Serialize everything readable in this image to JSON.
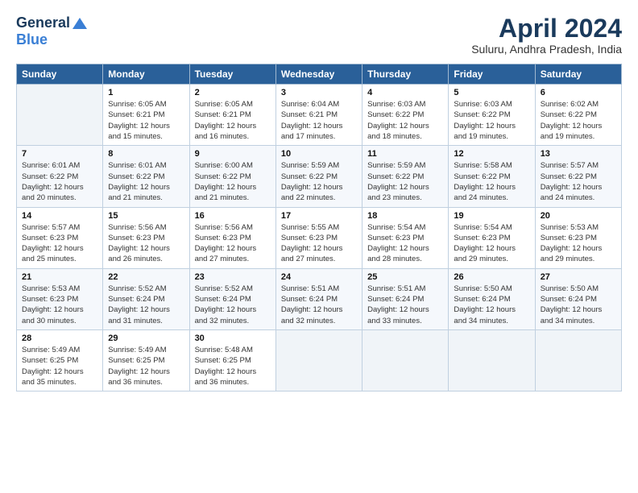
{
  "logo": {
    "general": "General",
    "blue": "Blue"
  },
  "header": {
    "title": "April 2024",
    "location": "Suluru, Andhra Pradesh, India"
  },
  "weekdays": [
    "Sunday",
    "Monday",
    "Tuesday",
    "Wednesday",
    "Thursday",
    "Friday",
    "Saturday"
  ],
  "weeks": [
    [
      {
        "day": "",
        "sunrise": "",
        "sunset": "",
        "daylight": ""
      },
      {
        "day": "1",
        "sunrise": "6:05 AM",
        "sunset": "6:21 PM",
        "daylight": "12 hours and 15 minutes."
      },
      {
        "day": "2",
        "sunrise": "6:05 AM",
        "sunset": "6:21 PM",
        "daylight": "12 hours and 16 minutes."
      },
      {
        "day": "3",
        "sunrise": "6:04 AM",
        "sunset": "6:21 PM",
        "daylight": "12 hours and 17 minutes."
      },
      {
        "day": "4",
        "sunrise": "6:03 AM",
        "sunset": "6:22 PM",
        "daylight": "12 hours and 18 minutes."
      },
      {
        "day": "5",
        "sunrise": "6:03 AM",
        "sunset": "6:22 PM",
        "daylight": "12 hours and 19 minutes."
      },
      {
        "day": "6",
        "sunrise": "6:02 AM",
        "sunset": "6:22 PM",
        "daylight": "12 hours and 19 minutes."
      }
    ],
    [
      {
        "day": "7",
        "sunrise": "6:01 AM",
        "sunset": "6:22 PM",
        "daylight": "12 hours and 20 minutes."
      },
      {
        "day": "8",
        "sunrise": "6:01 AM",
        "sunset": "6:22 PM",
        "daylight": "12 hours and 21 minutes."
      },
      {
        "day": "9",
        "sunrise": "6:00 AM",
        "sunset": "6:22 PM",
        "daylight": "12 hours and 21 minutes."
      },
      {
        "day": "10",
        "sunrise": "5:59 AM",
        "sunset": "6:22 PM",
        "daylight": "12 hours and 22 minutes."
      },
      {
        "day": "11",
        "sunrise": "5:59 AM",
        "sunset": "6:22 PM",
        "daylight": "12 hours and 23 minutes."
      },
      {
        "day": "12",
        "sunrise": "5:58 AM",
        "sunset": "6:22 PM",
        "daylight": "12 hours and 24 minutes."
      },
      {
        "day": "13",
        "sunrise": "5:57 AM",
        "sunset": "6:22 PM",
        "daylight": "12 hours and 24 minutes."
      }
    ],
    [
      {
        "day": "14",
        "sunrise": "5:57 AM",
        "sunset": "6:23 PM",
        "daylight": "12 hours and 25 minutes."
      },
      {
        "day": "15",
        "sunrise": "5:56 AM",
        "sunset": "6:23 PM",
        "daylight": "12 hours and 26 minutes."
      },
      {
        "day": "16",
        "sunrise": "5:56 AM",
        "sunset": "6:23 PM",
        "daylight": "12 hours and 27 minutes."
      },
      {
        "day": "17",
        "sunrise": "5:55 AM",
        "sunset": "6:23 PM",
        "daylight": "12 hours and 27 minutes."
      },
      {
        "day": "18",
        "sunrise": "5:54 AM",
        "sunset": "6:23 PM",
        "daylight": "12 hours and 28 minutes."
      },
      {
        "day": "19",
        "sunrise": "5:54 AM",
        "sunset": "6:23 PM",
        "daylight": "12 hours and 29 minutes."
      },
      {
        "day": "20",
        "sunrise": "5:53 AM",
        "sunset": "6:23 PM",
        "daylight": "12 hours and 29 minutes."
      }
    ],
    [
      {
        "day": "21",
        "sunrise": "5:53 AM",
        "sunset": "6:23 PM",
        "daylight": "12 hours and 30 minutes."
      },
      {
        "day": "22",
        "sunrise": "5:52 AM",
        "sunset": "6:24 PM",
        "daylight": "12 hours and 31 minutes."
      },
      {
        "day": "23",
        "sunrise": "5:52 AM",
        "sunset": "6:24 PM",
        "daylight": "12 hours and 32 minutes."
      },
      {
        "day": "24",
        "sunrise": "5:51 AM",
        "sunset": "6:24 PM",
        "daylight": "12 hours and 32 minutes."
      },
      {
        "day": "25",
        "sunrise": "5:51 AM",
        "sunset": "6:24 PM",
        "daylight": "12 hours and 33 minutes."
      },
      {
        "day": "26",
        "sunrise": "5:50 AM",
        "sunset": "6:24 PM",
        "daylight": "12 hours and 34 minutes."
      },
      {
        "day": "27",
        "sunrise": "5:50 AM",
        "sunset": "6:24 PM",
        "daylight": "12 hours and 34 minutes."
      }
    ],
    [
      {
        "day": "28",
        "sunrise": "5:49 AM",
        "sunset": "6:25 PM",
        "daylight": "12 hours and 35 minutes."
      },
      {
        "day": "29",
        "sunrise": "5:49 AM",
        "sunset": "6:25 PM",
        "daylight": "12 hours and 36 minutes."
      },
      {
        "day": "30",
        "sunrise": "5:48 AM",
        "sunset": "6:25 PM",
        "daylight": "12 hours and 36 minutes."
      },
      {
        "day": "",
        "sunrise": "",
        "sunset": "",
        "daylight": ""
      },
      {
        "day": "",
        "sunrise": "",
        "sunset": "",
        "daylight": ""
      },
      {
        "day": "",
        "sunrise": "",
        "sunset": "",
        "daylight": ""
      },
      {
        "day": "",
        "sunrise": "",
        "sunset": "",
        "daylight": ""
      }
    ]
  ],
  "labels": {
    "sunrise": "Sunrise:",
    "sunset": "Sunset:",
    "daylight": "Daylight:"
  }
}
